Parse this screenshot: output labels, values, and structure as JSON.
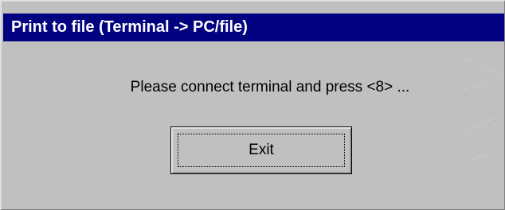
{
  "window": {
    "title": "Print to file (Terminal -> PC/file)"
  },
  "dialog": {
    "message": "Please connect terminal and press <8> ...",
    "exit_label": "Exit"
  },
  "colors": {
    "titlebar": "#000080",
    "title_text": "#ffffff",
    "background": "#c0c0c0"
  }
}
